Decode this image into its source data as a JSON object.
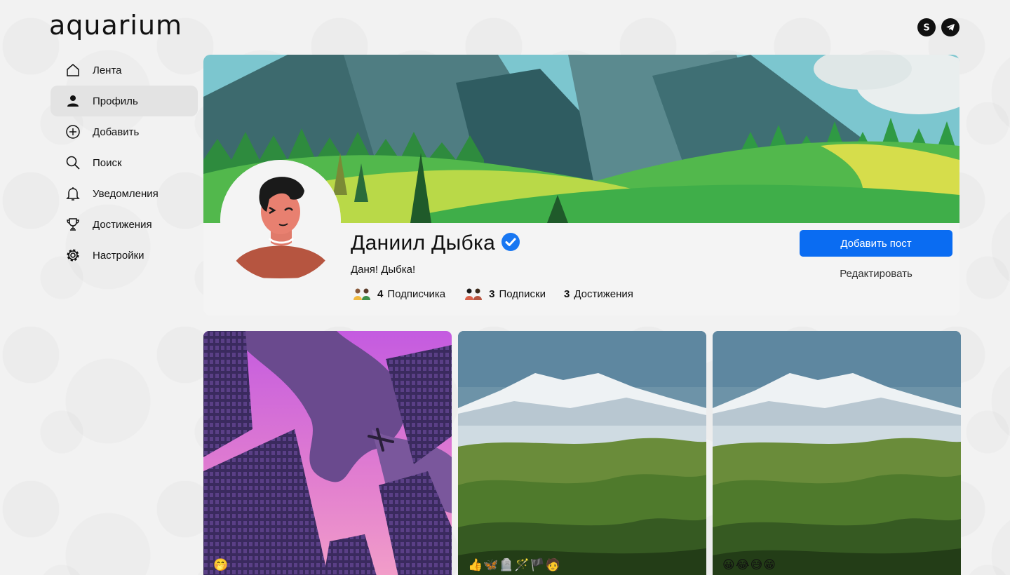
{
  "app": {
    "logo": "aquarium"
  },
  "header": {
    "icons": [
      "skype-icon",
      "telegram-icon"
    ]
  },
  "sidebar": {
    "items": [
      {
        "label": "Лента",
        "icon": "home-icon",
        "active": false
      },
      {
        "label": "Профиль",
        "icon": "user-icon",
        "active": true
      },
      {
        "label": "Добавить",
        "icon": "plus-circle-icon",
        "active": false
      },
      {
        "label": "Поиск",
        "icon": "search-icon",
        "active": false
      },
      {
        "label": "Уведомления",
        "icon": "bell-icon",
        "active": false
      },
      {
        "label": "Достижения",
        "icon": "trophy-icon",
        "active": false
      },
      {
        "label": "Настройки",
        "icon": "gear-icon",
        "active": false
      }
    ]
  },
  "profile": {
    "name": "Даниил Дыбка",
    "verified": true,
    "bio": "Даня! Дыбка!",
    "followers_count": "4",
    "followers_label": "Подписчика",
    "following_count": "3",
    "following_label": "Подписки",
    "achievements_count": "3",
    "achievements_label": "Достижения",
    "add_post_label": "Добавить пост",
    "edit_label": "Редактировать"
  },
  "posts": [
    {
      "image": "city-sky-illustration",
      "reactions": "🤭"
    },
    {
      "image": "snowy-mountain-photo",
      "reactions": "👍🦋🪦🪄🏴🧑"
    },
    {
      "image": "snowy-mountain-photo",
      "reactions": "😀😂😅😁"
    }
  ],
  "colors": {
    "accent": "#0a6cf2",
    "verified": "#1877f2"
  }
}
